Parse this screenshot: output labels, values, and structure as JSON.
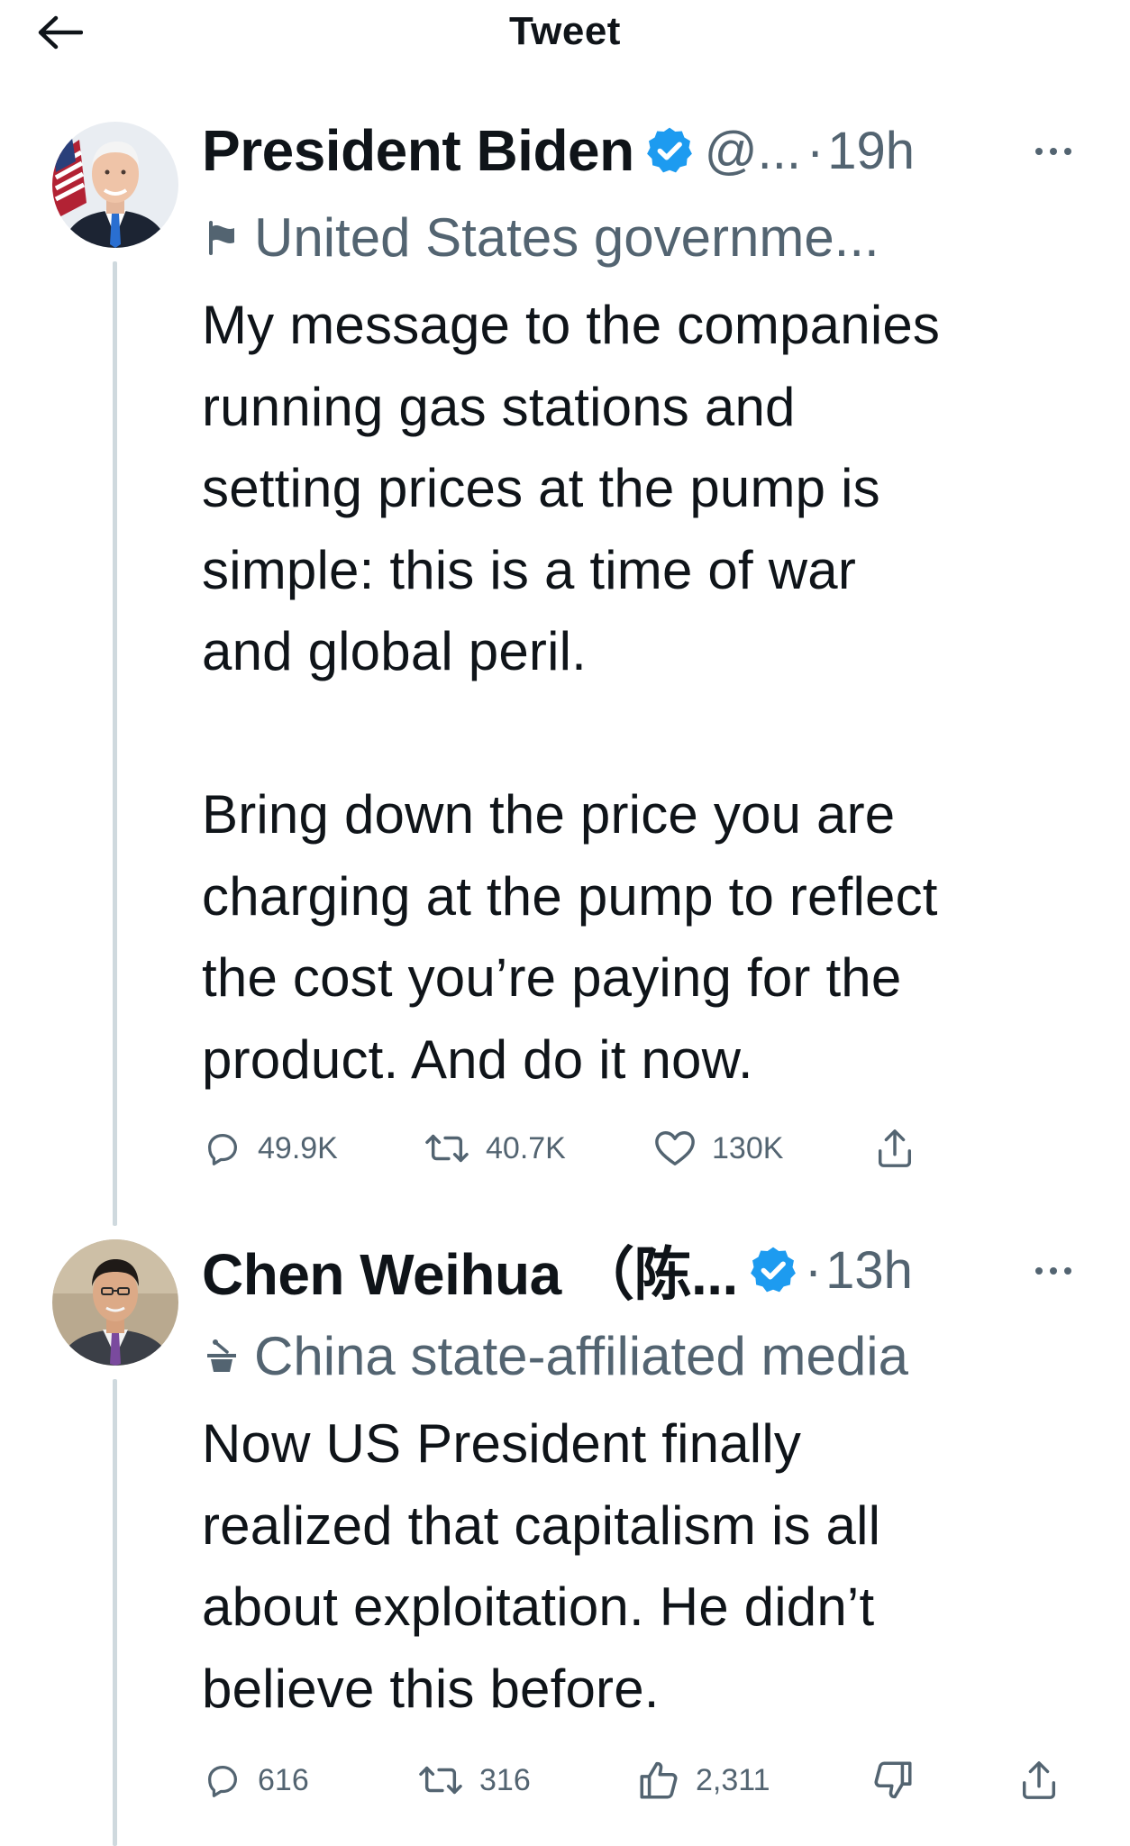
{
  "header": {
    "title": "Tweet",
    "back_icon": "arrow-left-icon"
  },
  "colors": {
    "text": "#0f1419",
    "secondary": "#536471",
    "verified_blue": "#1d9bf0",
    "thread_line": "#cfd9de"
  },
  "tweets": [
    {
      "author": "President Biden",
      "verified": true,
      "handle": "@...",
      "separator": "·",
      "time": "19h",
      "label_icon": "flag-icon",
      "label": "United States governme...",
      "text": "My message to the companies\nrunning gas stations and\nsetting prices at the pump is\nsimple: this is a time of war\nand global peril.\n\nBring down the price you are\ncharging at the pump to reflect\nthe cost you’re paying for the\nproduct. And do it now.",
      "actions": [
        {
          "icon": "reply-icon",
          "count": "49.9K"
        },
        {
          "icon": "retweet-icon",
          "count": "40.7K"
        },
        {
          "icon": "heart-icon",
          "count": "130K"
        },
        {
          "icon": "share-icon",
          "count": ""
        }
      ]
    },
    {
      "author": "Chen Weihua （陈...",
      "verified": true,
      "handle": "",
      "separator": "·",
      "time": "13h",
      "label_icon": "podium-icon",
      "label": "China state-affiliated media",
      "text": "Now US President finally\nrealized that capitalism is all\nabout exploitation. He didn’t\nbelieve this before.",
      "actions": [
        {
          "icon": "reply-icon",
          "count": "616"
        },
        {
          "icon": "retweet-icon",
          "count": "316"
        },
        {
          "icon": "thumbs-up-icon",
          "count": "2,311"
        },
        {
          "icon": "thumbs-down-icon",
          "count": ""
        },
        {
          "icon": "share-icon",
          "count": ""
        }
      ]
    }
  ]
}
